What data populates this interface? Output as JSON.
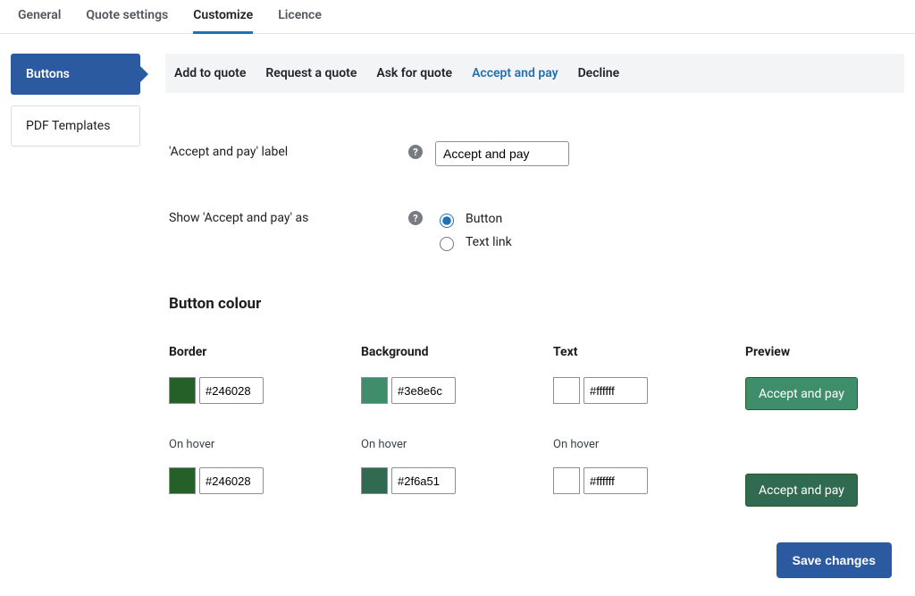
{
  "topTabs": {
    "items": [
      {
        "label": "General"
      },
      {
        "label": "Quote settings"
      },
      {
        "label": "Customize"
      },
      {
        "label": "Licence"
      }
    ],
    "active": "Customize"
  },
  "sidebar": {
    "items": [
      {
        "label": "Buttons"
      },
      {
        "label": "PDF Templates"
      }
    ],
    "active": "Buttons"
  },
  "subTabs": {
    "items": [
      {
        "label": "Add to quote"
      },
      {
        "label": "Request a quote"
      },
      {
        "label": "Ask for quote"
      },
      {
        "label": "Accept and pay"
      },
      {
        "label": "Decline"
      }
    ],
    "active": "Accept and pay"
  },
  "fields": {
    "labelField": {
      "label": "'Accept and pay' label",
      "value": "Accept and pay"
    },
    "showAs": {
      "label": "Show 'Accept and pay' as",
      "options": {
        "button": "Button",
        "link": "Text link"
      },
      "selected": "button"
    }
  },
  "section": {
    "title": "Button colour",
    "headers": {
      "border": "Border",
      "background": "Background",
      "text": "Text",
      "preview": "Preview"
    },
    "hoverLabel": "On hover"
  },
  "colors": {
    "border": {
      "normal": "#246028",
      "hover": "#246028"
    },
    "background": {
      "normal": "#3e8e6c",
      "hover": "#2f6a51"
    },
    "text": {
      "normal": "#ffffff",
      "hover": "#ffffff"
    }
  },
  "previewLabel": "Accept and pay",
  "save": {
    "label": "Save changes"
  },
  "icons": {
    "help": "?"
  }
}
